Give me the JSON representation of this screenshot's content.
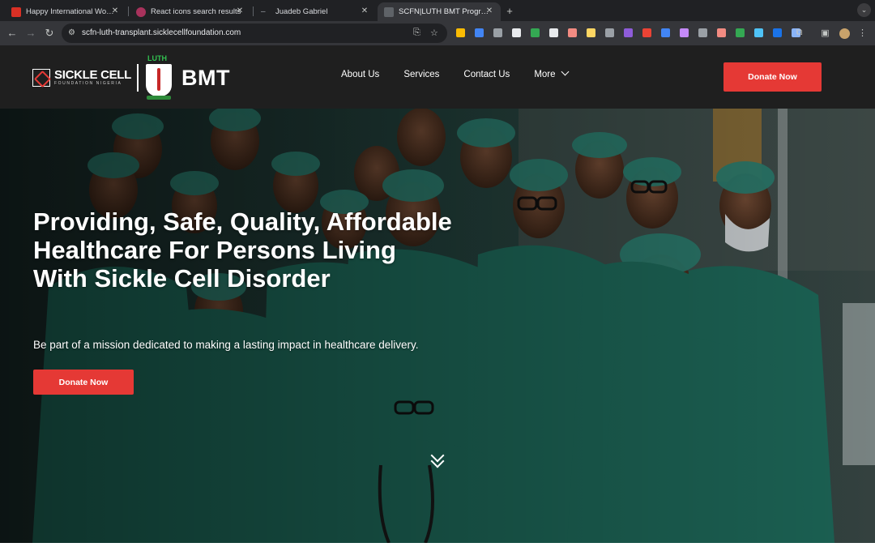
{
  "browser": {
    "tabs": [
      {
        "title": "Happy International Women's",
        "favicon_color": "#d93025",
        "favicon": "gmail-icon",
        "active": false
      },
      {
        "title": "React icons search results",
        "favicon_color": "#a8325c",
        "favicon": "react-icons-icon",
        "active": false
      },
      {
        "title": "Juadeb Gabriel",
        "favicon_color": "#9aa0a6",
        "favicon": "dash-icon",
        "active": false
      },
      {
        "title": "SCFN|LUTH BMT Program",
        "favicon_color": "#5f6368",
        "favicon": "site-icon",
        "active": true
      }
    ],
    "url": "scfn-luth-transplant.sicklecellfoundation.com",
    "extension_colors": [
      "#fbbc04",
      "#4285f4",
      "#9aa0a6",
      "#e8eaed",
      "#34a853",
      "#e8eaed",
      "#f28b82",
      "#fdd663",
      "#9aa0a6",
      "#8e5cd9",
      "#ea4335",
      "#4285f4",
      "#c58af9",
      "#9aa0a6",
      "#f28b82",
      "#34a853",
      "#4fc3f7",
      "#1a73e8",
      "#8ab4f8"
    ]
  },
  "site": {
    "logo": {
      "name": "SICKLE CELL",
      "sub": "FOUNDATION NIGERIA",
      "luth": "LUTH",
      "program": "BMT"
    },
    "nav": [
      {
        "label": "About Us"
      },
      {
        "label": "Services"
      },
      {
        "label": "Contact Us"
      },
      {
        "label": "More"
      }
    ],
    "donate_label": "Donate Now",
    "accent_color": "#e53935"
  },
  "hero": {
    "title": "Providing, Safe, Quality, Affordable Healthcare For Persons Living With Sickle Cell Disorder",
    "subtitle": "Be part of a mission dedicated to making a lasting impact in healthcare delivery.",
    "cta_label": "Donate Now",
    "scrub_color": "#1f6e5e"
  }
}
